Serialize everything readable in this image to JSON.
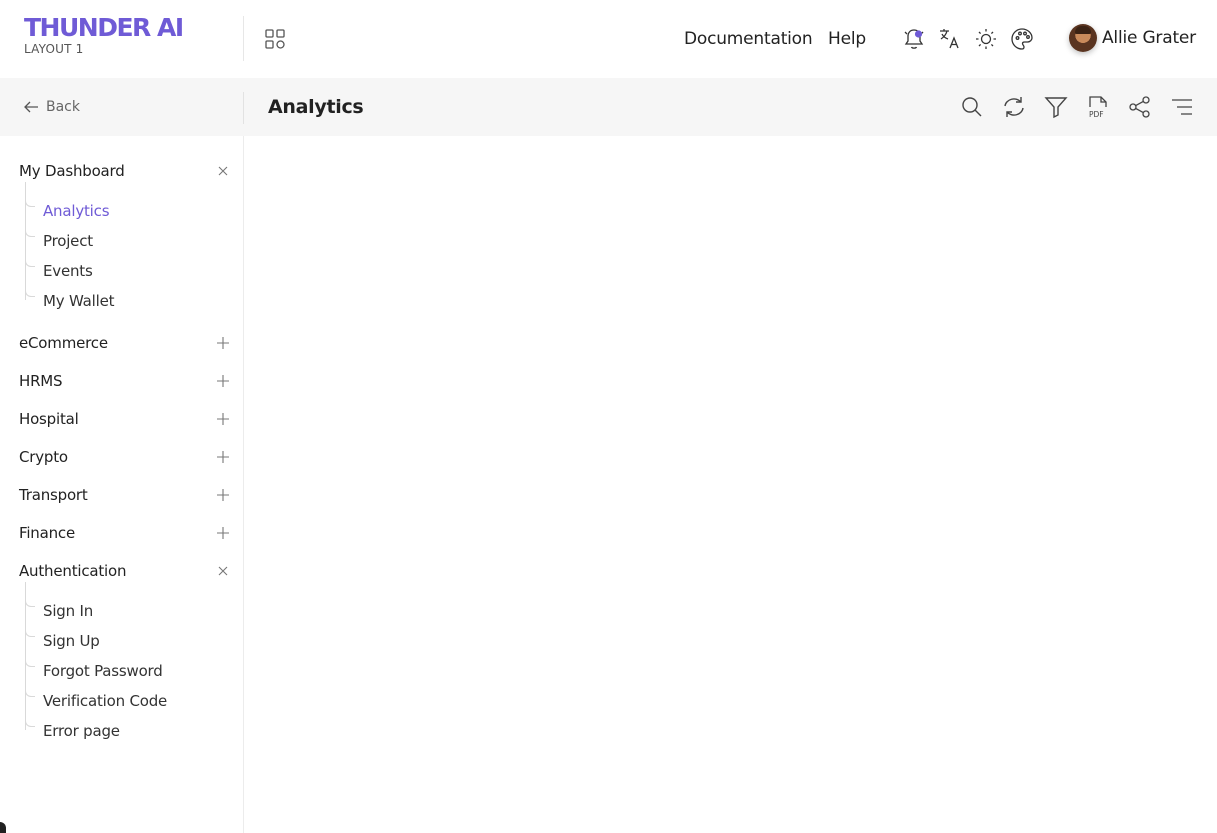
{
  "brand": {
    "name": "THUNDER AI",
    "layout": "LAYOUT 1"
  },
  "header": {
    "nav": [
      "Documentation",
      "Help"
    ],
    "icons": [
      "notification-bell-icon",
      "translate-icon",
      "sun-theme-icon",
      "palette-icon"
    ],
    "user": {
      "name": "Allie Grater"
    },
    "accent_color": "#6f5bd6"
  },
  "toolbar": {
    "back_label": "Back",
    "title": "Analytics",
    "icons": [
      "search-icon",
      "refresh-icon",
      "filter-icon",
      "pdf-icon",
      "share-icon",
      "menu-lines-icon"
    ]
  },
  "sidebar": {
    "groups": [
      {
        "label": "My Dashboard",
        "expanded": true,
        "items": [
          "Analytics",
          "Project",
          "Events",
          "My Wallet"
        ],
        "active": "Analytics"
      },
      {
        "label": "eCommerce",
        "expanded": false
      },
      {
        "label": "HRMS",
        "expanded": false
      },
      {
        "label": "Hospital",
        "expanded": false
      },
      {
        "label": "Crypto",
        "expanded": false
      },
      {
        "label": "Transport",
        "expanded": false
      },
      {
        "label": "Finance",
        "expanded": false
      },
      {
        "label": "Authentication",
        "expanded": true,
        "items": [
          "Sign In",
          "Sign Up",
          "Forgot Password",
          "Verification Code",
          "Error page"
        ]
      }
    ]
  }
}
